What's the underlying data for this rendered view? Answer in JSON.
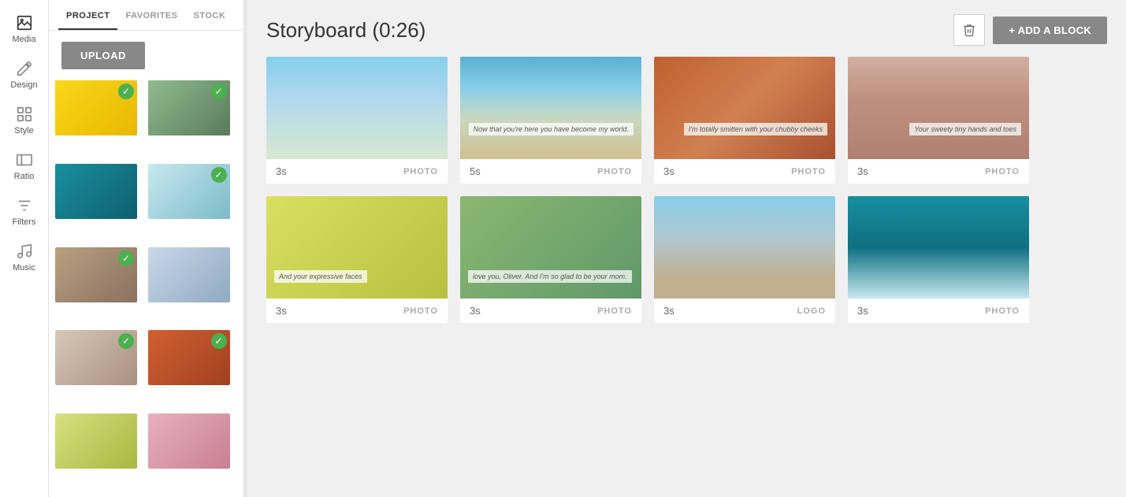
{
  "iconBar": {
    "items": [
      {
        "id": "media",
        "label": "Media",
        "icon": "image",
        "active": true
      },
      {
        "id": "design",
        "label": "Design",
        "icon": "pen"
      },
      {
        "id": "style",
        "label": "Style",
        "icon": "grid"
      },
      {
        "id": "ratio",
        "label": "Ratio",
        "icon": "ratio"
      },
      {
        "id": "filters",
        "label": "Filters",
        "icon": "filters"
      },
      {
        "id": "music",
        "label": "Music",
        "icon": "music"
      }
    ]
  },
  "leftPanel": {
    "tabs": [
      "PROJECT",
      "FAVORITES",
      "STOCK"
    ],
    "activeTab": "PROJECT",
    "uploadLabel": "UPLOAD"
  },
  "header": {
    "title": "Storyboard (0:26)",
    "deleteLabel": "",
    "addBlockLabel": "+ ADD A BLOCK"
  },
  "storyboard": {
    "rows": [
      [
        {
          "duration": "3s",
          "type": "PHOTO",
          "imgClass": "simg-sky",
          "overlay": ""
        },
        {
          "duration": "5s",
          "type": "PHOTO",
          "imgClass": "simg-coast",
          "overlay": "Now that you're here you have become my world."
        },
        {
          "duration": "3s",
          "type": "PHOTO",
          "imgClass": "simg-canyon",
          "overlay": "I'm totally smitten with your chubby cheeks"
        },
        {
          "duration": "3s",
          "type": "PHOTO",
          "imgClass": "simg-desert",
          "overlay": "Your sweety tiny hands and toes"
        }
      ],
      [
        {
          "duration": "3s",
          "type": "PHOTO",
          "imgClass": "simg-emoji",
          "overlay": "And your expressive faces"
        },
        {
          "duration": "3s",
          "type": "PHOTO",
          "imgClass": "simg-elephant",
          "overlay": "love you, Oliver. And I'm so glad to be your mom."
        },
        {
          "duration": "3s",
          "type": "LOGO",
          "imgClass": "simg-statue",
          "overlay": ""
        },
        {
          "duration": "3s",
          "type": "PHOTO",
          "imgClass": "simg-ocean",
          "overlay": ""
        }
      ]
    ]
  }
}
